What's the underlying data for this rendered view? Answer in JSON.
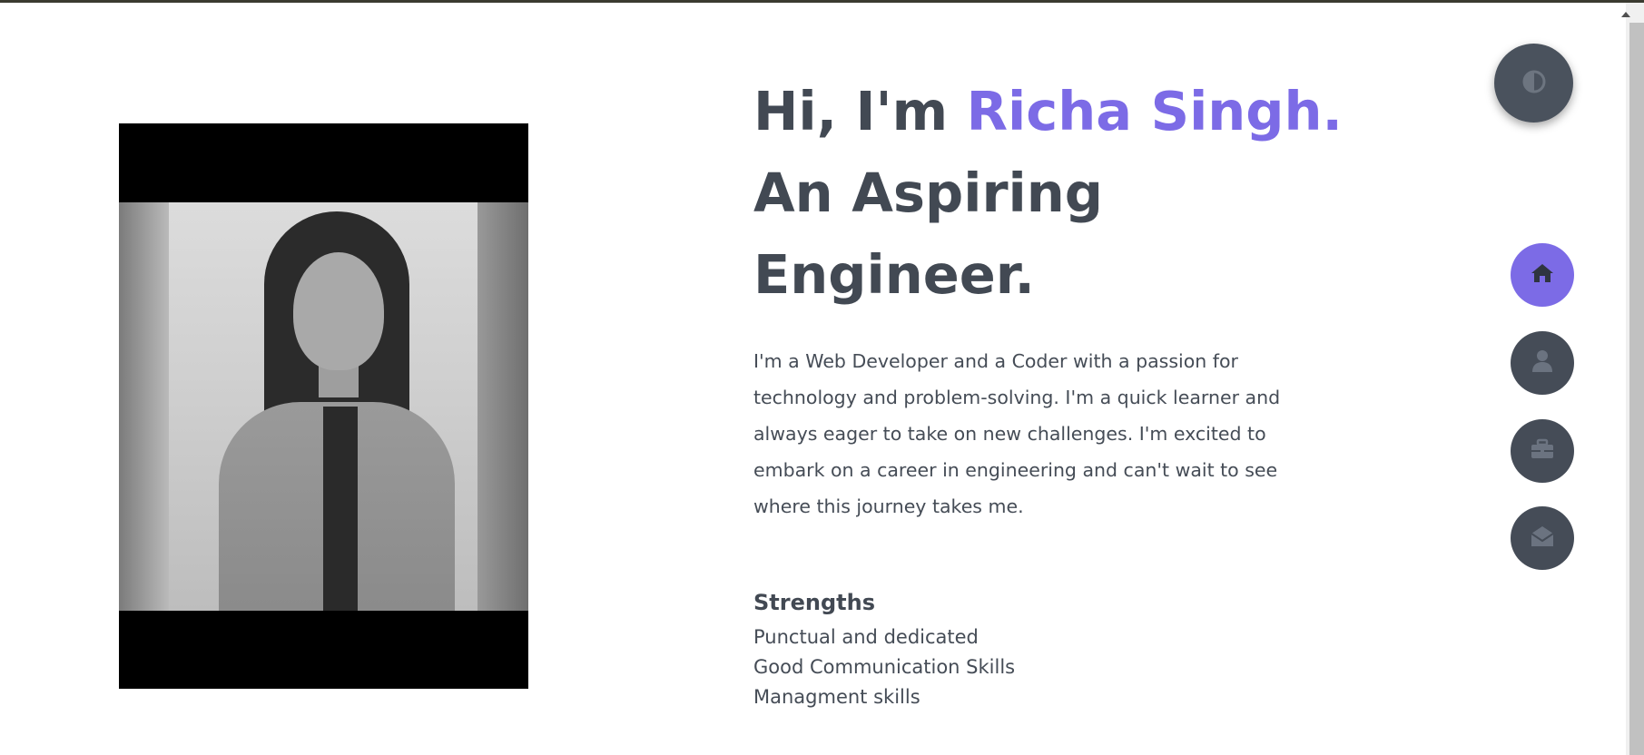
{
  "hero": {
    "greeting": "Hi, I'm ",
    "name": "Richa Singh.",
    "line2": "An Aspiring",
    "line3": "Engineer.",
    "intro": "I'm a Web Developer and a Coder with a passion for technology and problem-solving. I'm a quick learner and always eager to take on new challenges. I'm excited to embark on a career in engineering and can't wait to see where this journey takes me."
  },
  "strengths": {
    "title": "Strengths",
    "items": [
      "Punctual and dedicated",
      "Good Communication Skills",
      "Managment skills"
    ]
  },
  "nav": {
    "items": [
      {
        "icon": "home-icon",
        "active": true
      },
      {
        "icon": "user-icon",
        "active": false
      },
      {
        "icon": "briefcase-icon",
        "active": false
      },
      {
        "icon": "envelope-open-icon",
        "active": false
      }
    ]
  },
  "theme_toggle": {
    "icon": "contrast-icon"
  },
  "colors": {
    "accent": "#7c6be6",
    "text_dark": "#424953",
    "button_dark": "#454c57"
  }
}
